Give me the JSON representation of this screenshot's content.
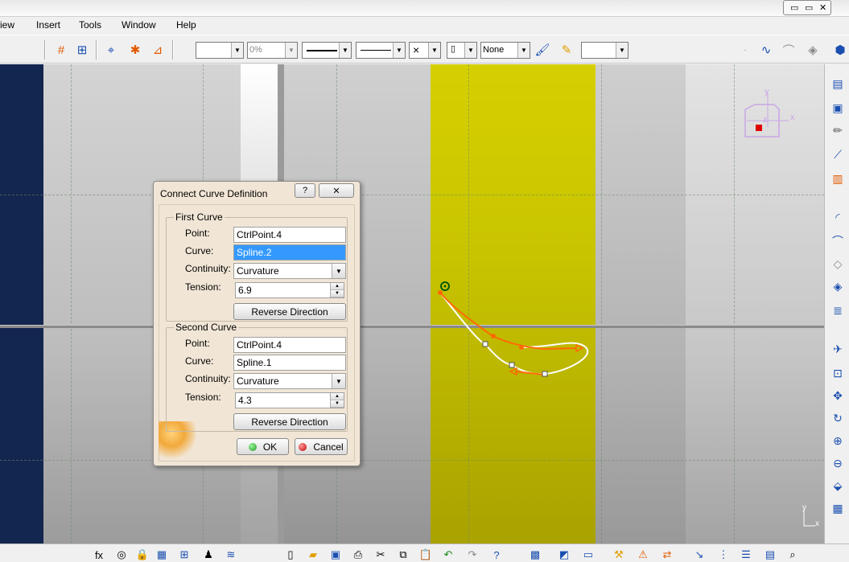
{
  "menu": {
    "items": [
      "iew",
      "Insert",
      "Tools",
      "Window",
      "Help"
    ]
  },
  "toolbar": {
    "color_combo": "",
    "transparency_combo": "0%",
    "layer_combo": "None",
    "last_combo": ""
  },
  "dialog": {
    "title": "Connect Curve Definition",
    "help_label": "?",
    "close_label": "✕",
    "first_curve": {
      "group_label": "First Curve",
      "point_label": "Point:",
      "point_value": "CtrlPoint.4",
      "curve_label": "Curve:",
      "curve_value": "Spline.2",
      "continuity_label": "Continuity:",
      "continuity_value": "Curvature",
      "tension_label": "Tension:",
      "tension_value": "6.9",
      "reverse_label": "Reverse Direction"
    },
    "second_curve": {
      "group_label": "Second Curve",
      "point_label": "Point:",
      "point_value": "CtrlPoint.4",
      "curve_label": "Curve:",
      "curve_value": "Spline.1",
      "continuity_label": "Continuity:",
      "continuity_value": "Curvature",
      "tension_label": "Tension:",
      "tension_value": "4.3",
      "reverse_label": "Reverse Direction"
    },
    "ok_label": "OK",
    "cancel_label": "Cancel"
  },
  "compass": {
    "x_label": "x",
    "y_label": "y",
    "z_label": "z"
  },
  "axis_corner": {
    "x_label": "x",
    "y_label": "y"
  },
  "colors": {
    "viewport_dark_band": "#13264f",
    "yellow_band": "#c8c400",
    "selection": "#3399ff",
    "curve_orange": "#ff6a00",
    "compass": "#c9a6e6"
  }
}
